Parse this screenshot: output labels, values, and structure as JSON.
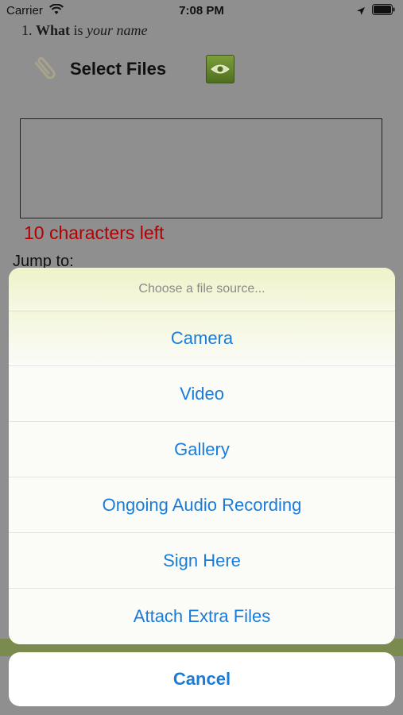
{
  "status_bar": {
    "carrier": "Carrier",
    "time": "7:08 PM"
  },
  "form": {
    "question_number": "1.",
    "question_bold": "What",
    "question_mid": "is",
    "question_italic": "your name",
    "select_files_label": "Select Files",
    "char_counter": "10 characters left",
    "jump_label": "Jump to:"
  },
  "action_sheet": {
    "title": "Choose a file source...",
    "items": [
      {
        "label": "Camera"
      },
      {
        "label": "Video"
      },
      {
        "label": "Gallery"
      },
      {
        "label": "Ongoing Audio Recording"
      },
      {
        "label": "Sign Here"
      },
      {
        "label": "Attach Extra Files"
      }
    ],
    "cancel_label": "Cancel"
  },
  "colors": {
    "action_blue": "#1a7cd9",
    "counter_red": "#b30000",
    "preview_green": "#6b8f2e"
  }
}
